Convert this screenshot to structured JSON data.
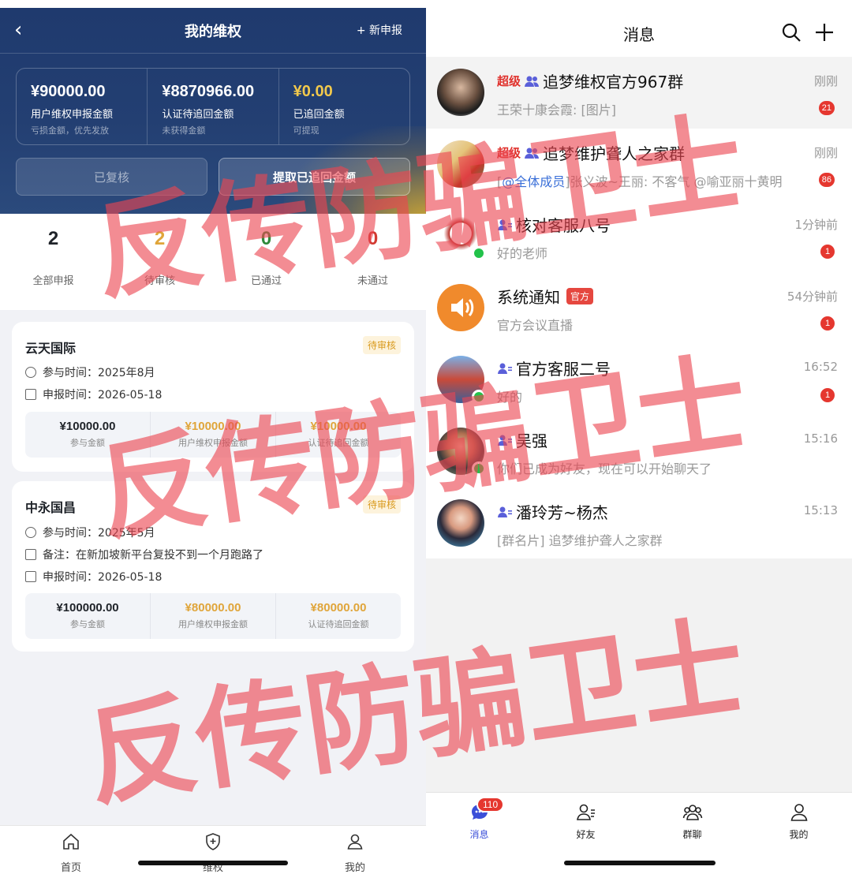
{
  "left": {
    "header": {
      "title": "我的维权",
      "back": "‹",
      "new_report": "+ 新申报"
    },
    "summary": [
      {
        "value": "¥90000.00",
        "label": "用户维权申报金额",
        "sub": "亏损金额，优先发放"
      },
      {
        "value": "¥8870966.00",
        "label": "认证待追回金额",
        "sub": "未获得金额"
      },
      {
        "value": "¥0.00",
        "label": "已追回金额",
        "sub": "可提现"
      }
    ],
    "buttons": {
      "reviewed": "已复核",
      "withdraw": "提取已追回金额"
    },
    "stats": [
      {
        "num": "2",
        "label": "全部申报",
        "color": "#1f2329"
      },
      {
        "num": "2",
        "label": "待审核",
        "color": "#e0a53a"
      },
      {
        "num": "0",
        "label": "已通过",
        "color": "#2f8a3a"
      },
      {
        "num": "0",
        "label": "未通过",
        "color": "#d23a32"
      }
    ],
    "cards": [
      {
        "title": "云天国际",
        "status": "待审核",
        "join_time": "参与时间：2025年8月",
        "report_time": "申报时间：2026-05-18",
        "amounts": [
          {
            "value": "¥10000.00",
            "label": "参与金额"
          },
          {
            "value": "¥10000.00",
            "label": "用户维权申报金额"
          },
          {
            "value": "¥10000.00",
            "label": "认证待追回金额"
          }
        ]
      },
      {
        "title": "中永国昌",
        "status": "待审核",
        "join_time": "参与时间：2025年5月",
        "remark": "备注：在新加坡新平台复投不到一个月跑路了",
        "report_time": "申报时间：2026-05-18",
        "amounts": [
          {
            "value": "¥100000.00",
            "label": "参与金额"
          },
          {
            "value": "¥80000.00",
            "label": "用户维权申报金额"
          },
          {
            "value": "¥80000.00",
            "label": "认证待追回金额"
          }
        ]
      }
    ],
    "tabbar": [
      {
        "label": "首页",
        "icon": "home-icon"
      },
      {
        "label": "维权",
        "icon": "shield-plus-icon"
      },
      {
        "label": "我的",
        "icon": "user-icon"
      }
    ]
  },
  "right": {
    "title": "消息",
    "chats": [
      {
        "tag": "超级",
        "name": "追梦维权官方967群",
        "time": "刚刚",
        "preview": "王荣十康会霞: [图片]",
        "unread": "21",
        "type": "group"
      },
      {
        "tag": "超级",
        "name": "追梦维护聋人之家群",
        "time": "刚刚",
        "preview_mention": "@全体成员",
        "preview": "]张义波~王丽: 不客气 @喻亚丽十黄明",
        "preview_open": "[",
        "unread": "86",
        "type": "group"
      },
      {
        "name": "核对客服八号",
        "time": "1分钟前",
        "preview": "好的老师",
        "unread": "1",
        "type": "user"
      },
      {
        "name": "系统通知",
        "official": "官方",
        "time": "54分钟前",
        "preview": "官方会议直播",
        "unread": "1",
        "type": "system"
      },
      {
        "name": "官方客服二号",
        "time": "16:52",
        "preview": "好的",
        "unread": "1",
        "type": "user"
      },
      {
        "name": "吴强",
        "time": "15:16",
        "preview": "你们已成为好友，现在可以开始聊天了",
        "type": "user"
      },
      {
        "name": "潘玲芳~杨杰",
        "time": "15:13",
        "preview": "[群名片] 追梦维护聋人之家群",
        "type": "user"
      }
    ],
    "tabbar": [
      {
        "label": "消息",
        "icon": "chat-icon",
        "badge": "110"
      },
      {
        "label": "好友",
        "icon": "friends-icon"
      },
      {
        "label": "群聊",
        "icon": "group-chat-icon"
      },
      {
        "label": "我的",
        "icon": "profile-icon"
      }
    ]
  },
  "watermark": "反传防骗卫士"
}
